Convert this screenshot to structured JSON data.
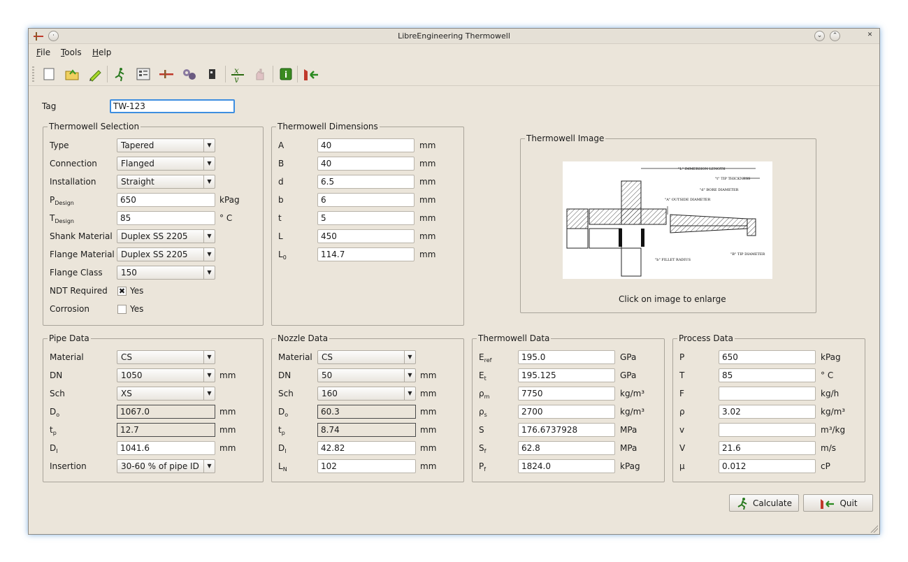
{
  "window": {
    "title": "LibreEngineering Thermowell"
  },
  "menu": {
    "file": "File",
    "tools": "Tools",
    "help": "Help"
  },
  "toolbar": [
    "new-icon",
    "open-icon",
    "save-icon",
    "run-icon",
    "list-icon",
    "thermowell-icon",
    "piping-icon",
    "connector-icon",
    "function-icon",
    "hand-icon",
    "info-icon",
    "quit-icon"
  ],
  "tag": {
    "label": "Tag",
    "value": "TW-123"
  },
  "selection": {
    "title": "Thermowell Selection",
    "type": {
      "label": "Type",
      "value": "Tapered"
    },
    "connection": {
      "label": "Connection",
      "value": "Flanged"
    },
    "installation": {
      "label": "Installation",
      "value": "Straight"
    },
    "p_design": {
      "label": "P",
      "sub": "Design",
      "value": "650",
      "unit": "kPag"
    },
    "t_design": {
      "label": "T",
      "sub": "Design",
      "value": "85",
      "unit": "° C"
    },
    "shank_material": {
      "label": "Shank Material",
      "value": "Duplex SS 2205"
    },
    "flange_material": {
      "label": "Flange Material",
      "value": "Duplex SS 2205"
    },
    "flange_class": {
      "label": "Flange Class",
      "value": "150"
    },
    "ndt": {
      "label": "NDT Required",
      "check_label": "Yes",
      "checked": true
    },
    "corrosion": {
      "label": "Corrosion",
      "check_label": "Yes",
      "checked": false
    }
  },
  "dimensions": {
    "title": "Thermowell Dimensions",
    "rows": [
      {
        "label": "A",
        "sub": "",
        "value": "40",
        "unit": "mm"
      },
      {
        "label": "B",
        "sub": "",
        "value": "40",
        "unit": "mm"
      },
      {
        "label": "d",
        "sub": "",
        "value": "6.5",
        "unit": "mm"
      },
      {
        "label": "b",
        "sub": "",
        "value": "6",
        "unit": "mm"
      },
      {
        "label": "t",
        "sub": "",
        "value": "5",
        "unit": "mm"
      },
      {
        "label": "L",
        "sub": "",
        "value": "450",
        "unit": "mm"
      },
      {
        "label": "L",
        "sub": "0",
        "value": "114.7",
        "unit": "mm"
      }
    ]
  },
  "image": {
    "title": "Thermowell Image",
    "caption": "Click on image to enlarge",
    "labels": {
      "l_immersion": "\"L\" IMMERSION LENGTH",
      "t_tip": "\"t\" TIP THICKNESS",
      "d_bore": "\"d\" BORE DIAMETER",
      "a_outside": "\"A\" OUTSIDE DIAMETER",
      "b_tip": "\"B\" TIP DIAMETER",
      "b_fillet": "\"b\" FILLET RADIUS"
    }
  },
  "pipe": {
    "title": "Pipe Data",
    "material": {
      "label": "Material",
      "value": "CS"
    },
    "dn": {
      "label": "DN",
      "value": "1050",
      "unit": "mm"
    },
    "sch": {
      "label": "Sch",
      "value": "XS"
    },
    "do": {
      "label": "D",
      "sub": "o",
      "value": "1067.0",
      "unit": "mm"
    },
    "tp": {
      "label": "t",
      "sub": "p",
      "value": "12.7",
      "unit": "mm"
    },
    "di": {
      "label": "D",
      "sub": "I",
      "value": "1041.6",
      "unit": "mm"
    },
    "insertion": {
      "label": "Insertion",
      "value": "30-60 % of pipe ID"
    }
  },
  "nozzle": {
    "title": "Nozzle Data",
    "material": {
      "label": "Material",
      "value": "CS"
    },
    "dn": {
      "label": "DN",
      "value": "50",
      "unit": "mm"
    },
    "sch": {
      "label": "Sch",
      "value": "160",
      "unit": "mm"
    },
    "do": {
      "label": "D",
      "sub": "o",
      "value": "60.3",
      "unit": "mm"
    },
    "tp": {
      "label": "t",
      "sub": "p",
      "value": "8.74",
      "unit": "mm"
    },
    "di": {
      "label": "D",
      "sub": "I",
      "value": "42.82",
      "unit": "mm"
    },
    "ln": {
      "label": "L",
      "sub": "N",
      "value": "102",
      "unit": "mm"
    }
  },
  "thermowell_data": {
    "title": "Thermowell Data",
    "rows": [
      {
        "label": "E",
        "sub": "ref",
        "value": "195.0",
        "unit": "GPa"
      },
      {
        "label": "E",
        "sub": "t",
        "value": "195.125",
        "unit": "GPa"
      },
      {
        "label": "ρ",
        "sub": "m",
        "value": "7750",
        "unit": "kg/m³"
      },
      {
        "label": "ρ",
        "sub": "s",
        "value": "2700",
        "unit": "kg/m³"
      },
      {
        "label": "S",
        "sub": "",
        "value": "176.6737928",
        "unit": "MPa"
      },
      {
        "label": "S",
        "sub": "f",
        "value": "62.8",
        "unit": "MPa"
      },
      {
        "label": "P",
        "sub": "f",
        "value": "1824.0",
        "unit": "kPag"
      }
    ]
  },
  "process": {
    "title": "Process Data",
    "rows": [
      {
        "label": "P",
        "value": "650",
        "unit": "kPag"
      },
      {
        "label": "T",
        "value": "85",
        "unit": "° C"
      },
      {
        "label": "F",
        "value": "",
        "unit": "kg/h"
      },
      {
        "label": "ρ",
        "value": "3.02",
        "unit": "kg/m³"
      },
      {
        "label": "v",
        "value": "",
        "unit": "m³/kg"
      },
      {
        "label": "V",
        "value": "21.6",
        "unit": "m/s"
      },
      {
        "label": "μ",
        "value": "0.012",
        "unit": "cP"
      }
    ]
  },
  "buttons": {
    "calculate": "Calculate",
    "quit": "Quit"
  }
}
